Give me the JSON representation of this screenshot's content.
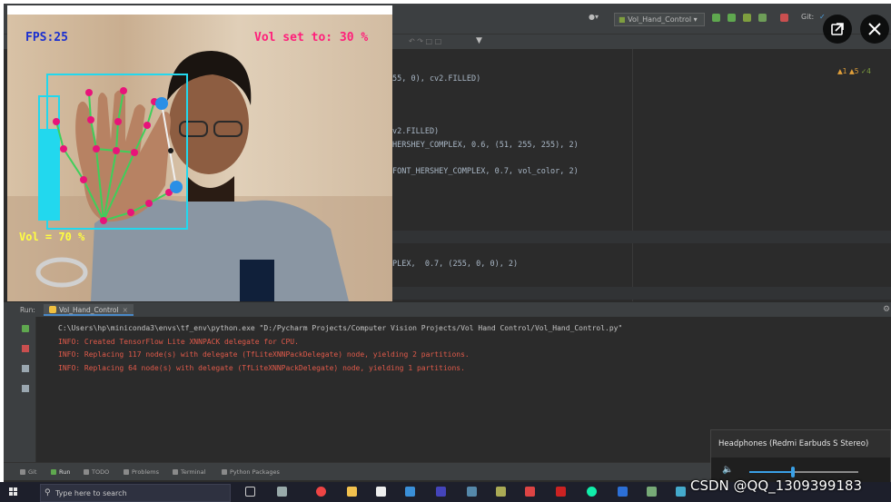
{
  "ide": {
    "branch_label": "Git:",
    "run_config": "Vol_Hand_Control",
    "warnings": {
      "w1": "▲1",
      "w2": "▲5",
      "ok": "✓4"
    },
    "code": [
      "55, 0), cv2.FILLED)",
      "v2.FILLED)",
      "HERSHEY_COMPLEX, 0.6, (51, 255, 255), 2)",
      "FONT_HERSHEY_COMPLEX, 0.7, vol_color, 2)",
      "PLEX,  0.7, (255, 0, 0), 2)"
    ]
  },
  "run_panel": {
    "label": "Run:",
    "tab": "Vol_Hand_Control",
    "console": {
      "path": "C:\\Users\\hp\\miniconda3\\envs\\tf_env\\python.exe \"D:/Pycharm Projects/Computer Vision Projects/Vol Hand Control/Vol_Hand_Control.py\"",
      "info1": "INFO: Created TensorFlow Lite XNNPACK delegate for CPU.",
      "info2": "INFO: Replacing 117 node(s) with delegate (TfLiteXNNPackDelegate) node, yielding 2 partitions.",
      "info3": "INFO: Replacing 64 node(s) with delegate (TfLiteXNNPackDelegate) node, yielding 1 partitions."
    }
  },
  "bottom_tabs": [
    "Git",
    "Run",
    "TODO",
    "Problems",
    "Terminal",
    "Python Packages"
  ],
  "webcam": {
    "fps": "FPS:25",
    "vol_set": "Vol set to: 30 %",
    "vol_readout": "Vol = 70 %",
    "colors": {
      "box": "#22d8ee",
      "joint": "#e8137a",
      "bone": "#3ecf5a",
      "fps": "#1a2fd0"
    }
  },
  "taskbar": {
    "search_placeholder": "Type here to search"
  },
  "sound": {
    "device": "Headphones (Redmi Earbuds S Stereo)",
    "level": 0.4
  },
  "watermark": "CSDN @QQ_1309399183"
}
